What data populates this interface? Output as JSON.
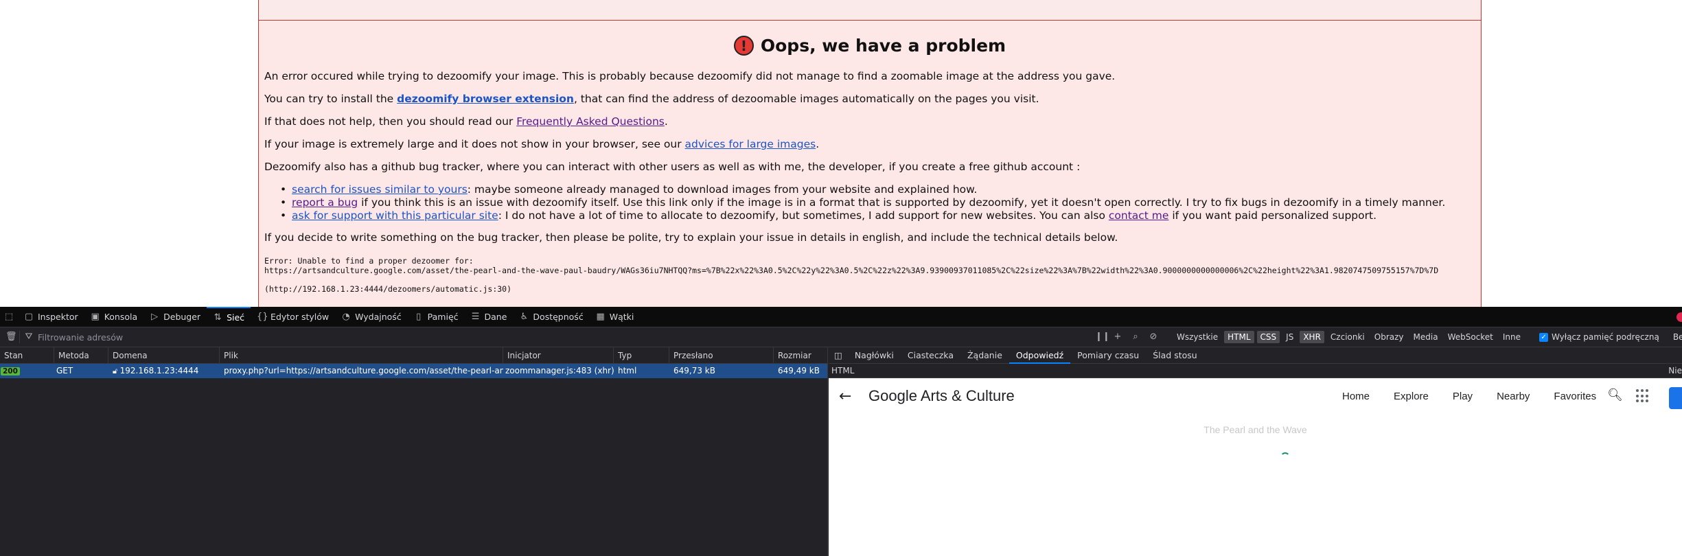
{
  "error_page": {
    "title": "Oops, we have a problem",
    "icon": "exclamation-circle-icon",
    "p1": "An error occured while trying to dezoomify your image. This is probably because dezoomify did not manage to find a zoomable image at the address you gave.",
    "p2_before": "You can try to install the ",
    "p2_link": "dezoomify browser extension",
    "p2_after": ", that can find the address of dezoomable images automatically on the pages you visit.",
    "p3_before": "If that does not help, then you should read our ",
    "p3_link": "Frequently Asked Questions",
    "p3_after": ".",
    "p4_before": "If your image is extremely large and it does not show in your browser, see our ",
    "p4_link": "advices for large images",
    "p4_after": ".",
    "p5": "Dezoomify also has a github bug tracker, where you can interact with other users as well as with me, the developer, if you create a free github account :",
    "bullets": [
      {
        "link": "search for issues similar to yours",
        "after": ": maybe someone already managed to download images from your website and explained how."
      },
      {
        "link": "report a bug",
        "after": " if you think this is an issue with dezoomify itself. Use this link only if the image is in a format that is supported by dezoomify, yet it doesn't open correctly. I try to fix bugs in dezoomify in a timely manner."
      },
      {
        "link": "ask for support with this particular site",
        "after": ": I do not have a lot of time to allocate to dezoomify, but sometimes, I add support for new websites. You can also ",
        "link2": "contact me",
        "after2": " if you want paid personalized support."
      }
    ],
    "p6": "If you decide to write something on the bug tracker, then please be polite, try to explain your issue in details in english, and include the technical details below.",
    "error_line1": "Error: Unable to find a proper dezoomer for:",
    "error_line2": "https://artsandculture.google.com/asset/the-pearl-and-the-wave-paul-baudry/WAGs36iu7NHTQQ?ms=%7B%22x%22%3A0.5%2C%22y%22%3A0.5%2C%22z%22%3A9.93900937011085%2C%22size%22%3A%7B%22width%22%3A0.9000000000000006%2C%22height%22%3A1.9820747509755157%7D%7D",
    "error_line3": "(http://192.168.1.23:4444/dezoomers/automatic.js:30)"
  },
  "devtools": {
    "tabs": [
      {
        "label": "Inspektor",
        "icon": "inspector-icon"
      },
      {
        "label": "Konsola",
        "icon": "console-icon"
      },
      {
        "label": "Debuger",
        "icon": "debugger-icon"
      },
      {
        "label": "Sieć",
        "icon": "network-icon"
      },
      {
        "label": "Edytor stylów",
        "icon": "style-editor-icon"
      },
      {
        "label": "Wydajność",
        "icon": "performance-icon"
      },
      {
        "label": "Pamięć",
        "icon": "memory-icon"
      },
      {
        "label": "Dane",
        "icon": "storage-icon"
      },
      {
        "label": "Dostępność",
        "icon": "accessibility-icon"
      },
      {
        "label": "Wątki",
        "icon": "threads-icon"
      }
    ],
    "filter_placeholder": "Filtrowanie adresów",
    "type_filters": [
      "Wszystkie",
      "HTML",
      "CSS",
      "JS",
      "XHR",
      "Czcionki",
      "Obrazy",
      "Media",
      "WebSocket",
      "Inne"
    ],
    "cache_label": "Wyłącz pamięć podręczną",
    "bez_label": "Bez o",
    "columns": [
      "Stan",
      "Metoda",
      "Domena",
      "Plik",
      "Inicjator",
      "Typ",
      "Przesłano",
      "Rozmiar"
    ],
    "request": {
      "status": "200",
      "method": "GET",
      "domain": "192.168.1.23:4444",
      "file": "proxy.php?url=https://artsandculture.google.com/asset/the-pearl-and-the-wave",
      "initiator": "zoommanager.js:483 (xhr)",
      "type": "html",
      "transferred": "649,73 kB",
      "size": "649,49 kB"
    },
    "detail_tabs": [
      "Nagłówki",
      "Ciasteczka",
      "Żądanie",
      "Odpowiedź",
      "Pomiary czasu",
      "Ślad stosu"
    ],
    "detail_sub_label": "HTML",
    "detail_sub_right": "Nie",
    "preview": {
      "logo": "Google Arts & Culture",
      "nav": [
        "Home",
        "Explore",
        "Play",
        "Nearby",
        "Favorites"
      ],
      "page_title": "The Pearl and the Wave"
    }
  }
}
